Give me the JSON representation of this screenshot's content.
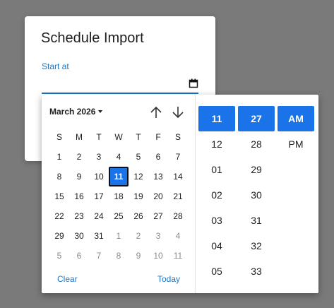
{
  "dialog": {
    "title": "Schedule Import",
    "field_label": "Start at"
  },
  "picker": {
    "month_label": "March 2026",
    "weekdays": [
      "S",
      "M",
      "T",
      "W",
      "T",
      "F",
      "S"
    ],
    "weeks": [
      [
        "1",
        "2",
        "3",
        "4",
        "5",
        "6",
        "7"
      ],
      [
        "8",
        "9",
        "10",
        "11",
        "12",
        "13",
        "14"
      ],
      [
        "15",
        "16",
        "17",
        "18",
        "19",
        "20",
        "21"
      ],
      [
        "22",
        "23",
        "24",
        "25",
        "26",
        "27",
        "28"
      ],
      [
        "29",
        "30",
        "31",
        "1",
        "2",
        "3",
        "4"
      ],
      [
        "5",
        "6",
        "7",
        "8",
        "9",
        "10",
        "11"
      ]
    ],
    "selected_day": "11",
    "clear_label": "Clear",
    "today_label": "Today",
    "hours": [
      "11",
      "12",
      "01",
      "02",
      "03",
      "04",
      "05"
    ],
    "minutes": [
      "27",
      "28",
      "29",
      "30",
      "31",
      "32",
      "33"
    ],
    "ampm": [
      "AM",
      "PM"
    ],
    "selected_hour": "11",
    "selected_minute": "27",
    "selected_ampm": "AM"
  },
  "colors": {
    "accent": "#1a73e8",
    "link": "#1f76c2",
    "backdrop": "#7a7a7a"
  },
  "icons": {
    "field": "calendar-icon",
    "prev": "arrow-up-icon",
    "next": "arrow-down-icon",
    "month_menu": "caret-down-icon"
  }
}
